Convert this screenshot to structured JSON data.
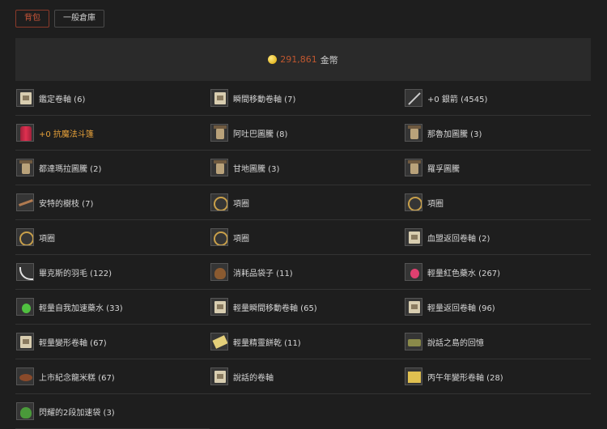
{
  "tabs": [
    {
      "label": "背包",
      "active": true
    },
    {
      "label": "一般倉庫",
      "active": false
    }
  ],
  "gold": {
    "amount": "291,861",
    "unit": "金幣",
    "icon": "coin-icon"
  },
  "items": [
    {
      "name": "鑑定卷軸 (6)",
      "icon": "scroll"
    },
    {
      "name": "瞬間移動卷軸 (7)",
      "icon": "scroll"
    },
    {
      "name": "+0 銀箭 (4545)",
      "icon": "arrow"
    },
    {
      "name": "+0 抗魔法斗篷",
      "icon": "cloak",
      "color": "#e8a23a"
    },
    {
      "name": "阿吐巴圖騰 (8)",
      "icon": "totem"
    },
    {
      "name": "那魯加圖騰 (3)",
      "icon": "totem"
    },
    {
      "name": "都達瑪拉圖騰 (2)",
      "icon": "totem"
    },
    {
      "name": "甘地圖騰 (3)",
      "icon": "totem"
    },
    {
      "name": "羅孚圖騰",
      "icon": "totem"
    },
    {
      "name": "安特的樹枝 (7)",
      "icon": "twig"
    },
    {
      "name": "項圈",
      "icon": "necklace"
    },
    {
      "name": "項圈",
      "icon": "necklace"
    },
    {
      "name": "項圈",
      "icon": "necklace"
    },
    {
      "name": "項圈",
      "icon": "necklace"
    },
    {
      "name": "血盟返回卷軸 (2)",
      "icon": "scroll"
    },
    {
      "name": "畢克斯的羽毛 (122)",
      "icon": "feather"
    },
    {
      "name": "消耗品袋子 (11)",
      "icon": "bag"
    },
    {
      "name": "輕量紅色藥水 (267)",
      "icon": "potion-red"
    },
    {
      "name": "輕量自我加速藥水 (33)",
      "icon": "potion-green"
    },
    {
      "name": "輕量瞬間移動卷軸 (65)",
      "icon": "scroll"
    },
    {
      "name": "輕量返回卷軸 (96)",
      "icon": "scroll"
    },
    {
      "name": "輕量變形卷軸 (67)",
      "icon": "scroll"
    },
    {
      "name": "輕量精靈餅乾 (11)",
      "icon": "cookie"
    },
    {
      "name": "說話之島的回憶",
      "icon": "tank"
    },
    {
      "name": "上市紀念龍米糕 (67)",
      "icon": "cake"
    },
    {
      "name": "說話的卷軸",
      "icon": "scroll"
    },
    {
      "name": "丙午年變形卷軸 (28)",
      "icon": "ticket"
    },
    {
      "name": "閃耀的2段加速袋 (3)",
      "icon": "pouch"
    }
  ]
}
